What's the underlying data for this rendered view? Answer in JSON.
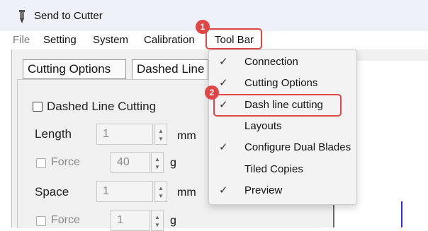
{
  "window": {
    "title": "Send to Cutter",
    "icon": "pen-knife-icon"
  },
  "menubar": {
    "items": [
      {
        "label": "File",
        "disabled": true
      },
      {
        "label": "Setting"
      },
      {
        "label": "System"
      },
      {
        "label": "Calibration"
      },
      {
        "label": "Tool Bar"
      }
    ]
  },
  "callouts": {
    "step1": "1",
    "step2": "2",
    "color": "#e04646"
  },
  "tabs": [
    {
      "label": "Cutting Options"
    },
    {
      "label": "Dashed Line Cutting"
    }
  ],
  "panel": {
    "dashed_checkbox_label": "Dashed Line Cutting",
    "length_label": "Length",
    "length_value": "1",
    "length_unit": "mm",
    "force1_label": "Force",
    "force1_value": "40",
    "force1_unit": "g",
    "space_label": "Space",
    "space_value": "1",
    "space_unit": "mm",
    "force2_label": "Force",
    "force2_value": "1",
    "force2_unit": "g"
  },
  "toolbar_menu": {
    "items": [
      {
        "label": "Connection",
        "checked": true,
        "check": "✓"
      },
      {
        "label": "Cutting Options",
        "checked": true,
        "check": "✓"
      },
      {
        "label": "Dash line cutting",
        "checked": true,
        "check": "✓"
      },
      {
        "label": "Layouts",
        "checked": false,
        "check": ""
      },
      {
        "label": "Configure Dual Blades",
        "checked": true,
        "check": "✓"
      },
      {
        "label": "Tiled Copies",
        "checked": false,
        "check": ""
      },
      {
        "label": "Preview",
        "checked": true,
        "check": "✓"
      }
    ]
  }
}
